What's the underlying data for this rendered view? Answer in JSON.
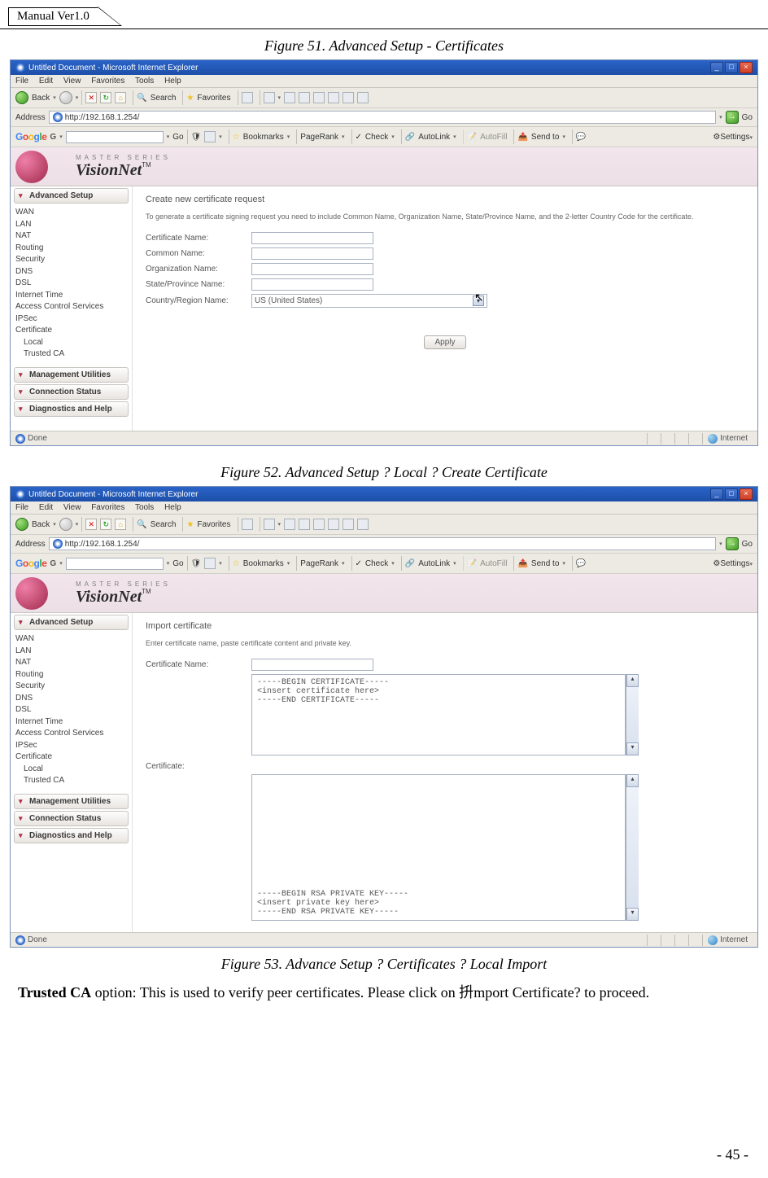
{
  "header": {
    "manual_version": "Manual Ver1.0"
  },
  "captions": {
    "fig51": "Figure 51. Advanced Setup - Certificates",
    "fig52": "Figure 52. Advanced Setup ? Local ? Create Certificate",
    "fig53": "Figure 53. Advance Setup ? Certificates ? Local Import"
  },
  "browser": {
    "title": "Untitled Document - Microsoft Internet Explorer",
    "menus": [
      "File",
      "Edit",
      "View",
      "Favorites",
      "Tools",
      "Help"
    ],
    "nav": {
      "back": "Back",
      "search": "Search",
      "favorites": "Favorites"
    },
    "address_label": "Address",
    "address_value": "http://192.168.1.254/",
    "go_label": "Go",
    "google": {
      "go": "Go",
      "bookmarks": "Bookmarks",
      "pagerank": "PageRank",
      "check": "Check",
      "autolink": "AutoLink",
      "autofill": "AutoFill",
      "sendto": "Send to",
      "settings": "Settings"
    },
    "statusbar": {
      "done": "Done",
      "internet": "Internet"
    }
  },
  "visionnet": {
    "master": "MASTER SERIES",
    "name": "VisionNet",
    "tm": "TM"
  },
  "sidebar": {
    "heads": {
      "advanced_setup": "Advanced Setup",
      "management_utilities": "Management Utilities",
      "connection_status": "Connection Status",
      "diagnostics_help": "Diagnostics and Help"
    },
    "items": [
      "WAN",
      "LAN",
      "NAT",
      "Routing",
      "Security",
      "DNS",
      "DSL",
      "Internet Time",
      "Access Control Services",
      "IPSec",
      "Certificate"
    ],
    "cert_children": [
      "Local",
      "Trusted CA"
    ]
  },
  "fig52_form": {
    "section_title": "Create new certificate request",
    "note": "To generate a certificate signing request you need to include Common Name, Organization Name, State/Province Name, and the 2-letter Country Code for the certificate.",
    "rows": {
      "cert_name": "Certificate Name:",
      "common_name": "Common Name:",
      "org_name": "Organization Name:",
      "state": "State/Province Name:",
      "country": "Country/Region Name:"
    },
    "country_value": "US (United States)",
    "apply": "Apply"
  },
  "fig53_form": {
    "section_title": "Import certificate",
    "note": "Enter certificate name, paste certificate content and private key.",
    "cert_name_label": "Certificate Name:",
    "cert_label": "Certificate:",
    "cert_text": "-----BEGIN CERTIFICATE-----\n<insert certificate here>\n-----END CERTIFICATE-----",
    "key_text": "-----BEGIN RSA PRIVATE KEY-----\n<insert private key here>\n-----END RSA PRIVATE KEY-----"
  },
  "body_text": {
    "trusted_ca_bold": "Trusted CA",
    "trusted_ca_rest": " option: This is used to verify peer certificates. Please click on 抍mport Certificate? to proceed."
  },
  "footer": {
    "page": "- 45 -"
  }
}
